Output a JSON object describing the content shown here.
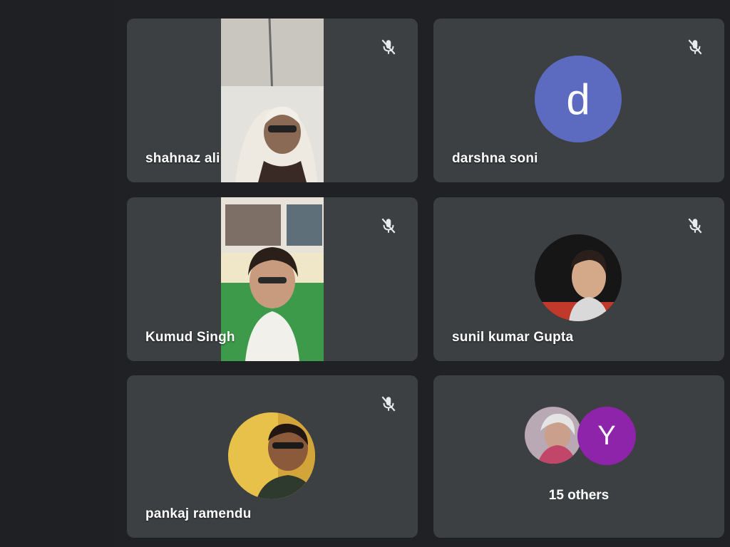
{
  "participants": [
    {
      "name": "shahnaz ali",
      "muted": true,
      "has_video": true
    },
    {
      "name": "darshna soni",
      "muted": true,
      "avatar_letter": "d",
      "avatar_color": "#5c6bc0"
    },
    {
      "name": "Kumud Singh",
      "muted": true,
      "has_video": true
    },
    {
      "name": "sunil kumar Gupta",
      "muted": true,
      "avatar": "photo"
    },
    {
      "name": "pankaj ramendu",
      "muted": true,
      "avatar": "photo"
    }
  ],
  "others": {
    "label": "15 others",
    "avatar_letter": "Y",
    "avatar_color": "#8e24aa"
  },
  "colors": {
    "background": "#202124",
    "tile": "#3c4043",
    "text": "#ffffff"
  },
  "icons": [
    "mic-off-icon"
  ]
}
